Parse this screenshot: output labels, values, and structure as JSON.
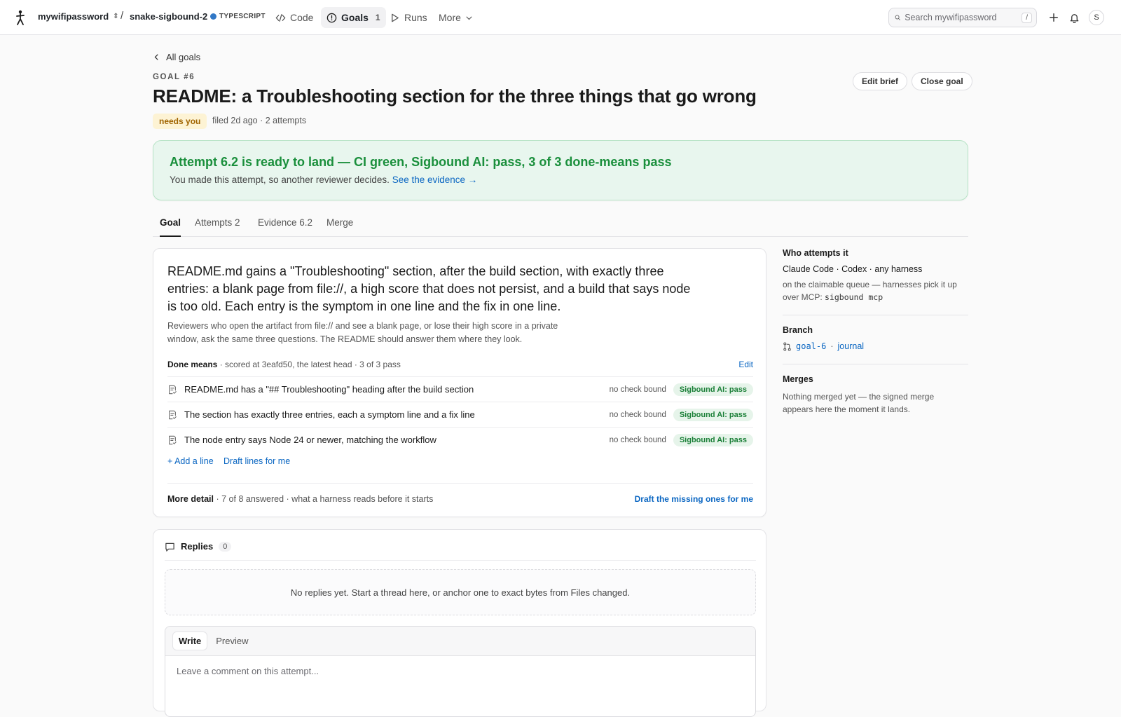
{
  "topbar": {
    "org": "mywifipassword",
    "slash": "/",
    "repo": "snake-sigbound-2",
    "language": "TYPESCRIPT",
    "nav": {
      "code": "Code",
      "goals": "Goals",
      "goals_count": "1",
      "runs": "Runs",
      "more": "More"
    },
    "search_placeholder": "Search mywifipassword",
    "search_shortcut": "/",
    "avatar_initial": "S"
  },
  "header": {
    "back": "All goals",
    "goal_number": "GOAL #6",
    "title": "README: a Troubleshooting section for the three things that go wrong",
    "edit_brief": "Edit brief",
    "close_goal": "Close goal",
    "status_badge": "needs you",
    "meta": "filed 2d ago · 2 attempts"
  },
  "banner": {
    "title": "Attempt 6.2 is ready to land — CI green, Sigbound AI: pass, 3 of 3 done-means pass",
    "subtitle": "You made this attempt, so another reviewer decides.",
    "link": "See the evidence →"
  },
  "tabs": {
    "goal": "Goal",
    "attempts": "Attempts 2",
    "evidence": "Evidence 6.2",
    "merge": "Merge"
  },
  "goal": {
    "lead": "README.md gains a \"Troubleshooting\" section, after the build section, with exactly three entries: a blank page from file://, a high score that does not persist, and a build that says node is too old. Each entry is the symptom in one line and the fix in one line.",
    "sub": "Reviewers who open the artifact from file:// and see a blank page, or lose their high score in a private window, ask the same three questions. The README should answer them where they look.",
    "done_means_label": "Done means",
    "done_means_meta": "· scored at 3eafd50, the latest head · 3 of 3 pass",
    "edit": "Edit",
    "criteria": [
      {
        "text": "README.md has a \"## Troubleshooting\" heading after the build section",
        "check": "no check bound",
        "status": "Sigbound AI: pass"
      },
      {
        "text": "The section has exactly three entries, each a symptom line and a fix line",
        "check": "no check bound",
        "status": "Sigbound AI: pass"
      },
      {
        "text": "The node entry says Node 24 or newer, matching the workflow",
        "check": "no check bound",
        "status": "Sigbound AI: pass"
      }
    ],
    "add_line": "+ Add a line",
    "draft_lines": "Draft lines for me",
    "more_detail_label": "More detail",
    "more_detail_meta": "· 7 of 8 answered · what a harness reads before it starts",
    "draft_missing": "Draft the missing ones for me"
  },
  "sidebar": {
    "who_title": "Who attempts it",
    "who_line": "Claude Code · Codex · any harness",
    "who_sub": "on the claimable queue — harnesses pick it up over MCP:",
    "who_cmd": "sigbound mcp",
    "branch_title": "Branch",
    "branch_name": "goal-6",
    "branch_sep": "·",
    "branch_journal": "journal",
    "merges_title": "Merges",
    "merges_text": "Nothing merged yet — the signed merge appears here the moment it lands."
  },
  "replies": {
    "title": "Replies",
    "count": "0",
    "empty": "No replies yet. Start a thread here, or anchor one to exact bytes from Files changed.",
    "write": "Write",
    "preview": "Preview",
    "placeholder": "Leave a comment on this attempt..."
  },
  "colors": {
    "accent_link": "#0a66c2",
    "success": "#1a8f3c",
    "warning_badge_bg": "#fdf3d4",
    "language_dot": "#3178c6"
  },
  "icons": [
    "logo-icon",
    "chevron-updown-icon",
    "code-icon",
    "goal-circle-icon",
    "play-icon",
    "chevron-down-icon",
    "search-icon",
    "plus-icon",
    "bell-icon",
    "chevron-left-icon",
    "document-check-icon",
    "branch-icon",
    "comment-icon"
  ]
}
